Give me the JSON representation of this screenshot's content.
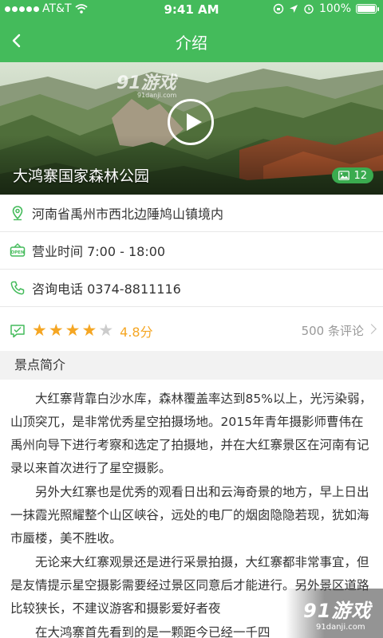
{
  "status_bar": {
    "carrier": "AT&T",
    "time": "9:41 AM",
    "battery": "100%",
    "battery_level": 1.0
  },
  "nav": {
    "title": "介绍"
  },
  "hero": {
    "watermark": "91游戏",
    "watermark_url": "91danji.com",
    "title": "大鸿寨国家森林公园",
    "photo_count": "12"
  },
  "info": {
    "address": "河南省禹州市西北边陲鸠山镇境内",
    "hours": "营业时间 7:00 - 18:00",
    "phone": "咨询电话 0374-8811116",
    "rating": "4.8分",
    "stars": 4,
    "max_stars": 5,
    "reviews": "500 条评论"
  },
  "section": {
    "title": "景点简介",
    "paragraphs": [
      "大红寨背靠白沙水库，森林覆盖率达到85%以上，光污染弱，山顶突兀，是非常优秀星空拍摄场地。2015年青年摄影师曹伟在禹州向导下进行考察和选定了拍摄地，并在大红寨景区在河南有记录以来首次进行了星空摄影。",
      "另外大红寨也是优秀的观看日出和云海奇景的地方，早上日出一抹霞光照耀整个山区峡谷，远处的电厂的烟囱隐隐若现，犹如海市蜃楼，美不胜收。",
      "无论来大红寨观景还是进行采景拍摄，大红寨都非常事宜，但是友情提示星空摄影需要经过景区同意后才能进行。另外景区道路比较狭长，不建议游客和摄影爱好者夜",
      "在大鸿寨首先看到的是一颗距今已经一千四"
    ]
  },
  "corner_logo": {
    "text": "91游戏",
    "url": "91danji.com"
  },
  "colors": {
    "brand_green": "#44bb5b",
    "star_orange": "#f5a623"
  }
}
